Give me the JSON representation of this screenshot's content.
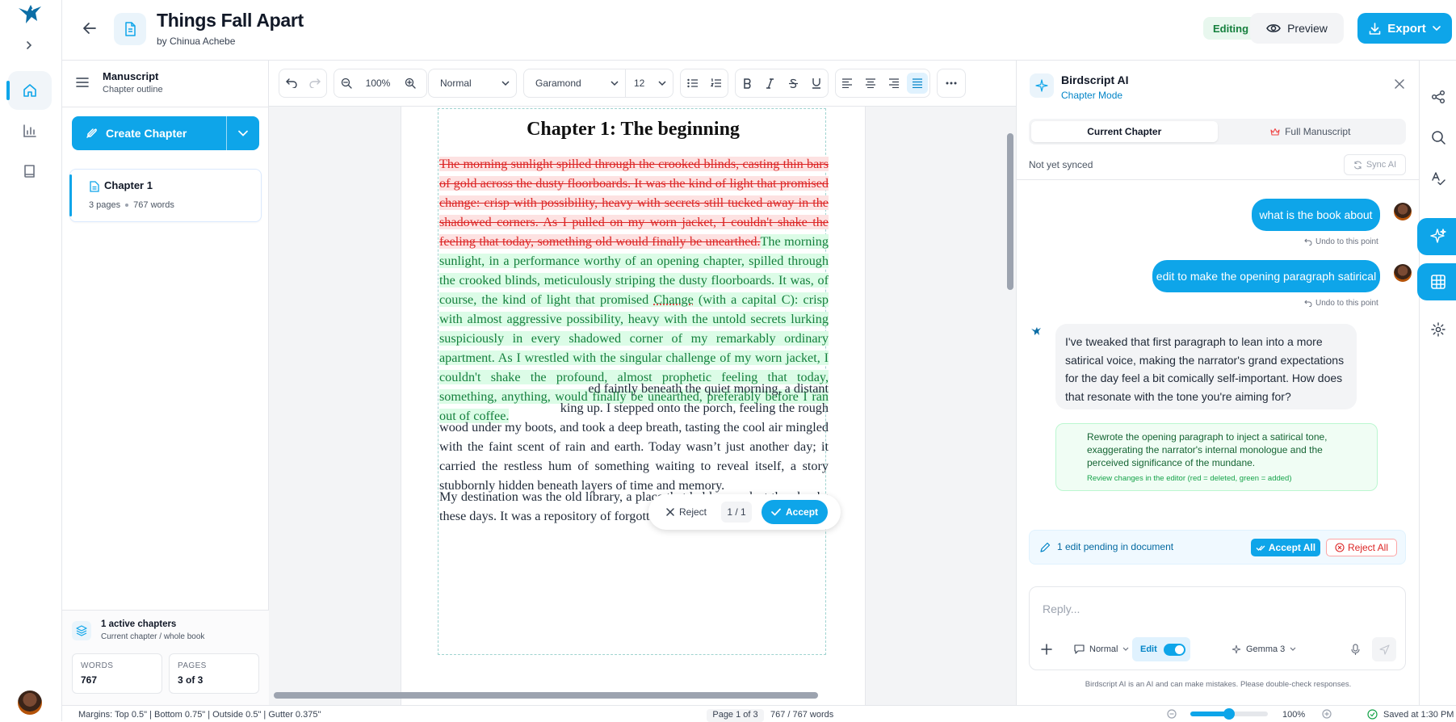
{
  "header": {
    "title": "Things Fall Apart",
    "author": "by Chinua Achebe",
    "status": "Editing",
    "preview_label": "Preview",
    "export_label": "Export"
  },
  "rail": {
    "items": [
      {
        "name": "home-icon",
        "active": true
      },
      {
        "name": "chart-icon",
        "active": false
      },
      {
        "name": "book-icon",
        "active": false
      }
    ]
  },
  "manuscript": {
    "title": "Manuscript",
    "subtitle": "Chapter outline",
    "create_label": "Create Chapter",
    "chapters": [
      {
        "name": "Chapter 1",
        "pages": "3 pages",
        "words": "767 words"
      }
    ],
    "footer": {
      "title": "1 active chapters",
      "subtitle": "Current chapter / whole book",
      "words_label": "WORDS",
      "words_value": "767",
      "pages_label": "PAGES",
      "pages_value": "3 of 3"
    }
  },
  "toolbar": {
    "zoom": "100%",
    "style": "Normal",
    "font": "Garamond",
    "size": "12"
  },
  "document": {
    "chapter_title": "Chapter 1: The beginning",
    "deleted_text": "The morning sunlight spilled through the crooked blinds, casting thin bars of gold across the dusty floorboards. It was the kind of light that promised change: crisp with possibility, heavy with secrets still tucked away in the shadowed corners. As I pulled on my worn jacket, I couldn't shake the feeling that today, something old would finally be unearthed.",
    "inserted_a": "The morning sunlight, in a performance worthy of an opening chapter, spilled through the crooked blinds, meticulously striping the dusty floorboards. It was, of course, the kind of light that promised ",
    "inserted_word": "Change",
    "inserted_b": " (with a capital C): crisp with almost aggressive possibility, heavy with the untold secrets lurking suspiciously in every shadowed corner of my remarkably ordinary apartment. As I wrestled with the singular challenge of my worn jacket, I couldn't shake the profound, almost prophetic feeling that today, something, anything, would finally be unearthed, preferably before I ran out of coffee.",
    "para2_line1": "ed faintly beneath the quiet morning, a distant",
    "para2_line2": "king up. I stepped onto the porch, feeling the rough",
    "para2_rest": "wood under my boots, and took a deep breath, tasting the cool air mingled with the faint scent of rain and earth. Today wasn’t just another day; it carried the restless hum of something waiting to reveal itself, a story stubbornly hidden beneath layers of time and memory.",
    "para3": "My destination was the old library, a place that held more dust than books these days. It was a repository of forgotten histories, not just of the town,"
  },
  "review": {
    "reject_label": "Reject",
    "count": "1 / 1",
    "accept_label": "Accept"
  },
  "statusbar": {
    "margins": "Margins: Top 0.5\" | Bottom 0.75\" | Outside 0.5\" | Gutter 0.375\"",
    "page": "Page 1 of 3",
    "words": "767 / 767 words",
    "zoom": "100%",
    "zoom_level": 0.5,
    "saved": "Saved at 1:30 PM"
  },
  "ai": {
    "title": "Birdscript AI",
    "mode": "Chapter Mode",
    "tabs": [
      "Current Chapter",
      "Full Manuscript"
    ],
    "sync_status": "Not yet synced",
    "sync_label": "Sync AI",
    "messages": {
      "user1": "what is the book about",
      "user2": "edit to make the opening paragraph satirical",
      "undo": "Undo to this point",
      "assistant": "I've tweaked that first paragraph to lean into a more satirical voice, making the narrator's grand expectations for the day feel a bit comically self-important. How does that resonate with the tone you're aiming for?",
      "edit_desc": "Rewrote the opening paragraph to inject a satirical tone, exaggerating the narrator's internal monologue and the perceived significance of the mundane.",
      "edit_note": "Review changes in the editor (red = deleted, green = added)"
    },
    "pending": {
      "text": "1 edit pending in document",
      "accept_all": "Accept All",
      "reject_all": "Reject All"
    },
    "composer": {
      "placeholder": "Reply...",
      "mode": "Normal",
      "edit_label": "Edit",
      "model": "Gemma 3"
    },
    "disclaimer": "Birdscript AI is an AI and can make mistakes. Please double-check responses."
  },
  "colors": {
    "accent": "#0ea5e9",
    "deleted": "#dc2626",
    "added": "#15803d"
  }
}
